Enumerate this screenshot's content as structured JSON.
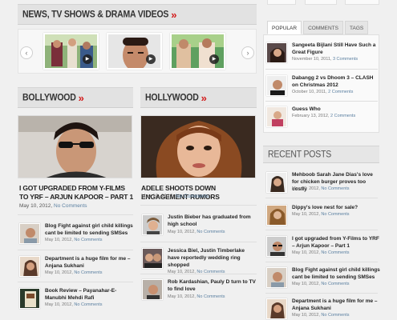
{
  "sections": {
    "videos_title": "NEWS, TV SHOWS & DRAMA VIDEOS",
    "bollywood_title": "BOLLYWOOD",
    "hollywood_title": "HOLLYWOOD",
    "recent_title": "RECENT POSTS",
    "chevron": "»"
  },
  "carousel": {
    "prev": "‹",
    "next": "›",
    "play": "▶"
  },
  "bollywood": {
    "hero_title": "I GOT UPGRADED FROM Y-FILMS TO YRF – ARJUN KAPOOR – PART 1",
    "hero_date": "May 10, 2012,",
    "hero_comments": "No Comments",
    "items": [
      {
        "title": "Blog Fight against girl child killings cant be limited to sending SMSes",
        "date": "May 10, 2012,",
        "comments": "No Comments"
      },
      {
        "title": "Department is a huge film for me – Anjana Sukhani",
        "date": "May 10, 2012,",
        "comments": "No Comments"
      },
      {
        "title": "Book Review – Payanahar-E-Manubhi Mehdi Rafi",
        "date": "May 10, 2012,",
        "comments": "No Comments"
      }
    ]
  },
  "hollywood": {
    "hero_title": "ADELE SHOOTS DOWN ENGAGEMENT RUMORS",
    "hero_date": "May 10, 2012,",
    "hero_comments": "No Comments",
    "items": [
      {
        "title": "Justin Bieber has graduated from high school",
        "date": "May 10, 2012,",
        "comments": "No Comments"
      },
      {
        "title": "Jessica Biel, Justin Timberlake have reportedly wedding ring shopped",
        "date": "May 10, 2012,",
        "comments": "No Comments"
      },
      {
        "title": "Rob Kardashian, Pauly D turn to TV to find love",
        "date": "May 10, 2012,",
        "comments": "No Comments"
      }
    ]
  },
  "sidebar": {
    "tabs": [
      "POPULAR",
      "COMMENTS",
      "TAGS"
    ],
    "popular": [
      {
        "title": "Sangeeta Bijlani Still Have Such a Great Figure",
        "date": "November 10, 2011,",
        "comments": "3 Comments"
      },
      {
        "title": "Dabangg 2 vs Dhoom 3 – CLASH on Christmas 2012",
        "date": "October 10, 2011,",
        "comments": "2 Comments"
      },
      {
        "title": "Guess Who",
        "date": "February 13, 2012,",
        "comments": "2 Comments"
      }
    ],
    "recent": [
      {
        "title": "Mehboob Sarah Jane Dias's love for chicken burger proves too costly",
        "date": "May 10, 2012,",
        "comments": "No Comments"
      },
      {
        "title": "Dippy's love nest for sale?",
        "date": "May 10, 2012,",
        "comments": "No Comments"
      },
      {
        "title": "I got upgraded from Y-Films to YRF – Arjun Kapoor – Part 1",
        "date": "May 10, 2012,",
        "comments": "No Comments"
      },
      {
        "title": "Blog Fight against girl child killings cant be limited to sending SMSes",
        "date": "May 10, 2012,",
        "comments": "No Comments"
      },
      {
        "title": "Department is a huge film for me – Anjana Sukhani",
        "date": "May 10, 2012,",
        "comments": "No Comments"
      }
    ]
  },
  "colors": {
    "accent": "#d21b1b",
    "link": "#5a7fa0",
    "header_bg": "#e2e2e2"
  }
}
